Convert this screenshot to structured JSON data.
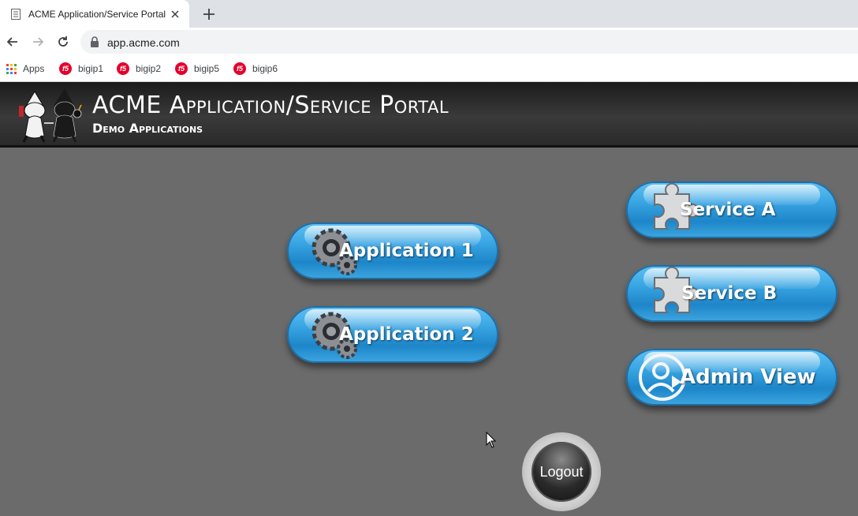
{
  "browser": {
    "tab_title": "ACME Application/Service Portal",
    "url": "app.acme.com",
    "bookmarks": [
      {
        "label": "Apps",
        "icon": "apps-grid-icon"
      },
      {
        "label": "bigip1",
        "icon": "f5-icon"
      },
      {
        "label": "bigip2",
        "icon": "f5-icon"
      },
      {
        "label": "bigip5",
        "icon": "f5-icon"
      },
      {
        "label": "bigip6",
        "icon": "f5-icon"
      }
    ]
  },
  "header": {
    "title": "ACME Application/Service Portal",
    "subtitle": "Demo Applications"
  },
  "buttons": {
    "application1": {
      "label": "Application 1",
      "icon": "gears-icon"
    },
    "application2": {
      "label": "Application 2",
      "icon": "gears-icon"
    },
    "serviceA": {
      "label": "Service A",
      "icon": "puzzle-piece-icon"
    },
    "serviceB": {
      "label": "Service B",
      "icon": "puzzle-piece-icon"
    },
    "adminView": {
      "label": "Admin View",
      "icon": "user-icon"
    },
    "logout": {
      "label": "Logout"
    }
  },
  "colors": {
    "button_blue": "#2a97d8",
    "header_bg": "#2b2b2b",
    "page_bg": "#6b6b6b"
  }
}
